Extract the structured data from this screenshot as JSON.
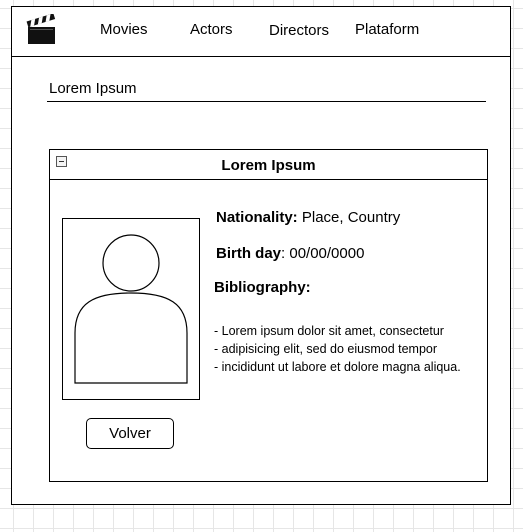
{
  "nav": {
    "logo_icon": "clapperboard-icon",
    "items": [
      {
        "label": "Movies"
      },
      {
        "label": "Actors"
      },
      {
        "label": "Directors"
      },
      {
        "label": "Plataform"
      }
    ]
  },
  "search": {
    "value": "",
    "placeholder": "Lorem Ipsum"
  },
  "panel": {
    "title": "Lorem Ipsum",
    "collapse_icon": "collapse-icon",
    "avatar_icon": "user-avatar-icon",
    "nationality_label": "Nationality:",
    "nationality_value": "Place, Country",
    "birthday_label": "Birth day",
    "birthday_value": ": 00/00/0000",
    "bibliography_label": "Bibliography:",
    "bibliography_items": [
      "- Lorem ipsum dolor sit amet, consectetur",
      "- adipisicing elit, sed do eiusmod tempor",
      "- incididunt ut labore et dolore magna aliqua."
    ],
    "back_button": "Volver"
  }
}
